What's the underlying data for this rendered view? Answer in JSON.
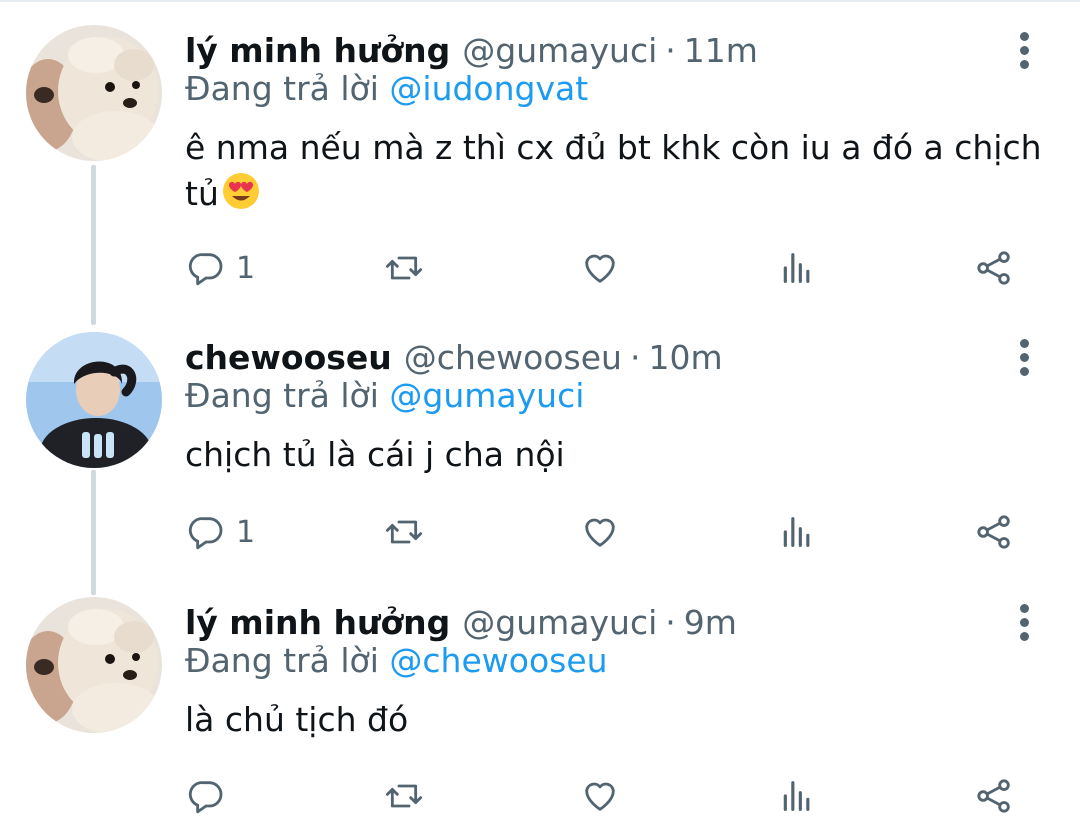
{
  "tweets": [
    {
      "display_name": "lý minh hưởng",
      "handle": "@gumayuci",
      "separator": "·",
      "time": "11m",
      "reply_prefix": "Đang trả lời",
      "reply_to": "@iudongvat",
      "text_line1": "ê nma nếu mà z thì cx đủ bt khk còn iu a đó a chịch",
      "text_line2": "tủ",
      "emoji": "smiling-face-with-heart-eyes",
      "reply_count": "1",
      "avatar": "pomeranian-dog-avatar"
    },
    {
      "display_name": "chewooseu",
      "handle": "@chewooseu",
      "separator": "·",
      "time": "10m",
      "reply_prefix": "Đang trả lời",
      "reply_to": "@gumayuci",
      "text_line1": "chịch tủ là cái j cha nội",
      "reply_count": "1",
      "avatar": "person-avatar"
    },
    {
      "display_name": "lý minh hưởng",
      "handle": "@gumayuci",
      "separator": "·",
      "time": "9m",
      "reply_prefix": "Đang trả lời",
      "reply_to": "@chewooseu",
      "text_line1": "là chủ tịch đó",
      "reply_count": "",
      "avatar": "pomeranian-dog-avatar"
    }
  ],
  "colors": {
    "text": "#0f1419",
    "secondary": "#536471",
    "mention": "#1d9bf0",
    "thread_line": "#cfd9de"
  }
}
